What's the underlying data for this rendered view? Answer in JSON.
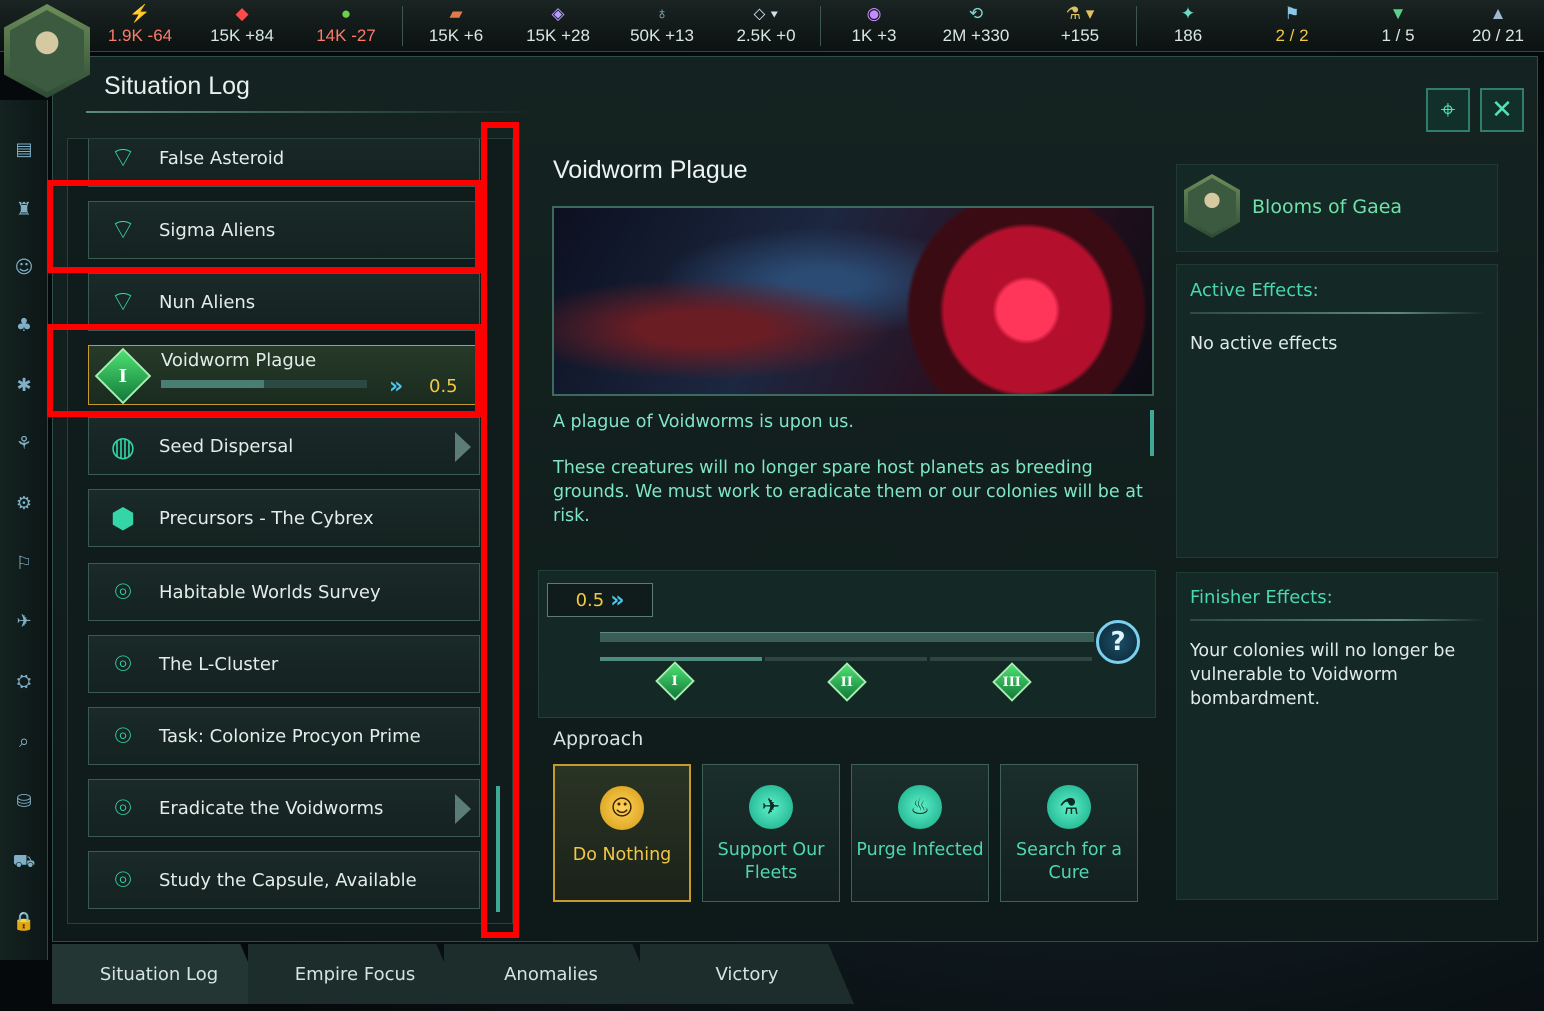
{
  "resources": [
    {
      "icon": "energy-icon",
      "glyph": "⚡",
      "value": "1.9K -64",
      "color": "#ff7a6a"
    },
    {
      "icon": "minerals-icon",
      "glyph": "◆",
      "value": "15K +84",
      "color": "#ffffff"
    },
    {
      "icon": "food-icon",
      "glyph": "●",
      "value": "14K -27",
      "color": "#ff7a6a"
    },
    {
      "icon": "alloys-icon",
      "glyph": "▰",
      "value": "15K +6",
      "color": "#ffffff"
    },
    {
      "icon": "consumer-goods-icon",
      "glyph": "◈",
      "value": "15K +28",
      "color": "#ffffff"
    },
    {
      "icon": "influence-icon",
      "glyph": "♁",
      "value": "50K +13",
      "color": "#ffffff"
    },
    {
      "icon": "unity-icon",
      "glyph": "⬦",
      "value": "2.5K +0",
      "color": "#ffffff"
    },
    {
      "icon": "research-icon",
      "glyph": "◉",
      "value": "1K +3",
      "color": "#ffffff"
    },
    {
      "icon": "trade-icon",
      "glyph": "⟲",
      "value": "2M +330",
      "color": "#ffffff"
    },
    {
      "icon": "science-icon",
      "glyph": "⚗",
      "value": "+155",
      "color": "#ffffff"
    },
    {
      "icon": "fleet-icon",
      "glyph": "✦",
      "value": "186",
      "color": "#ffffff"
    },
    {
      "icon": "envoys-icon",
      "glyph": "⚑",
      "value": "2 / 2",
      "color": "#f2c744"
    },
    {
      "icon": "starbase-icon",
      "glyph": "▼",
      "value": "1 / 5",
      "color": "#ffffff"
    },
    {
      "icon": "navy-icon",
      "glyph": "▲",
      "value": "20 / 21",
      "color": "#ffffff"
    }
  ],
  "window": {
    "title": "Situation Log"
  },
  "list_items": [
    {
      "label": "False Asteroid",
      "icon": "radar-dish-icon",
      "glyph": "📡"
    },
    {
      "label": "Sigma Aliens",
      "icon": "radar-dish-icon",
      "glyph": "📡"
    },
    {
      "label": "Nun Aliens",
      "icon": "radar-dish-icon",
      "glyph": "📡"
    },
    {
      "label": "Voidworm Plague",
      "icon": "situation-stage-one-icon",
      "glyph": "I",
      "progress": 0.5,
      "value": "0.5"
    },
    {
      "label": "Seed Dispersal",
      "icon": "planet-seed-icon",
      "glyph": "🌍"
    },
    {
      "label": "Precursors - The Cybrex",
      "icon": "precursor-icon",
      "glyph": "⬢"
    },
    {
      "label": "Habitable Worlds Survey",
      "icon": "map-pin-icon",
      "glyph": "⌾"
    },
    {
      "label": "The L-Cluster",
      "icon": "map-pin-icon",
      "glyph": "⌾"
    },
    {
      "label": "Task: Colonize Procyon Prime",
      "icon": "map-pin-icon",
      "glyph": "⌾"
    },
    {
      "label": "Eradicate the Voidworms",
      "icon": "map-pin-icon",
      "glyph": "⌾"
    },
    {
      "label": "Study the Capsule, Available",
      "icon": "map-pin-icon",
      "glyph": "⌾"
    }
  ],
  "detail": {
    "title": "Voidworm Plague",
    "desc1": "A plague of Voidworms is upon us.",
    "desc2": "These creatures will no longer spare host planets as breeding grounds. We must work to eradicate them or our colonies will be at risk.",
    "progress_value": "0.5",
    "progress_fraction": 0.33,
    "stages": [
      "I",
      "II",
      "III"
    ],
    "approach_label": "Approach",
    "approaches": [
      {
        "label": "Do Nothing",
        "icon": "do-nothing-icon",
        "glyph": "☺"
      },
      {
        "label": "Support Our Fleets",
        "icon": "fleet-support-icon",
        "glyph": "✈"
      },
      {
        "label": "Purge Infected",
        "icon": "purge-icon",
        "glyph": "♨"
      },
      {
        "label": "Search for a Cure",
        "icon": "microscope-icon",
        "glyph": "⚗"
      }
    ]
  },
  "right": {
    "owner": "Blooms of Gaea",
    "active_header": "Active Effects:",
    "active_text": "No active effects",
    "finisher_header": "Finisher Effects:",
    "finisher_text": "Your colonies will no longer be vulnerable to Voidworm bombardment."
  },
  "tabs": [
    "Situation Log",
    "Empire Focus",
    "Anomalies",
    "Victory"
  ]
}
